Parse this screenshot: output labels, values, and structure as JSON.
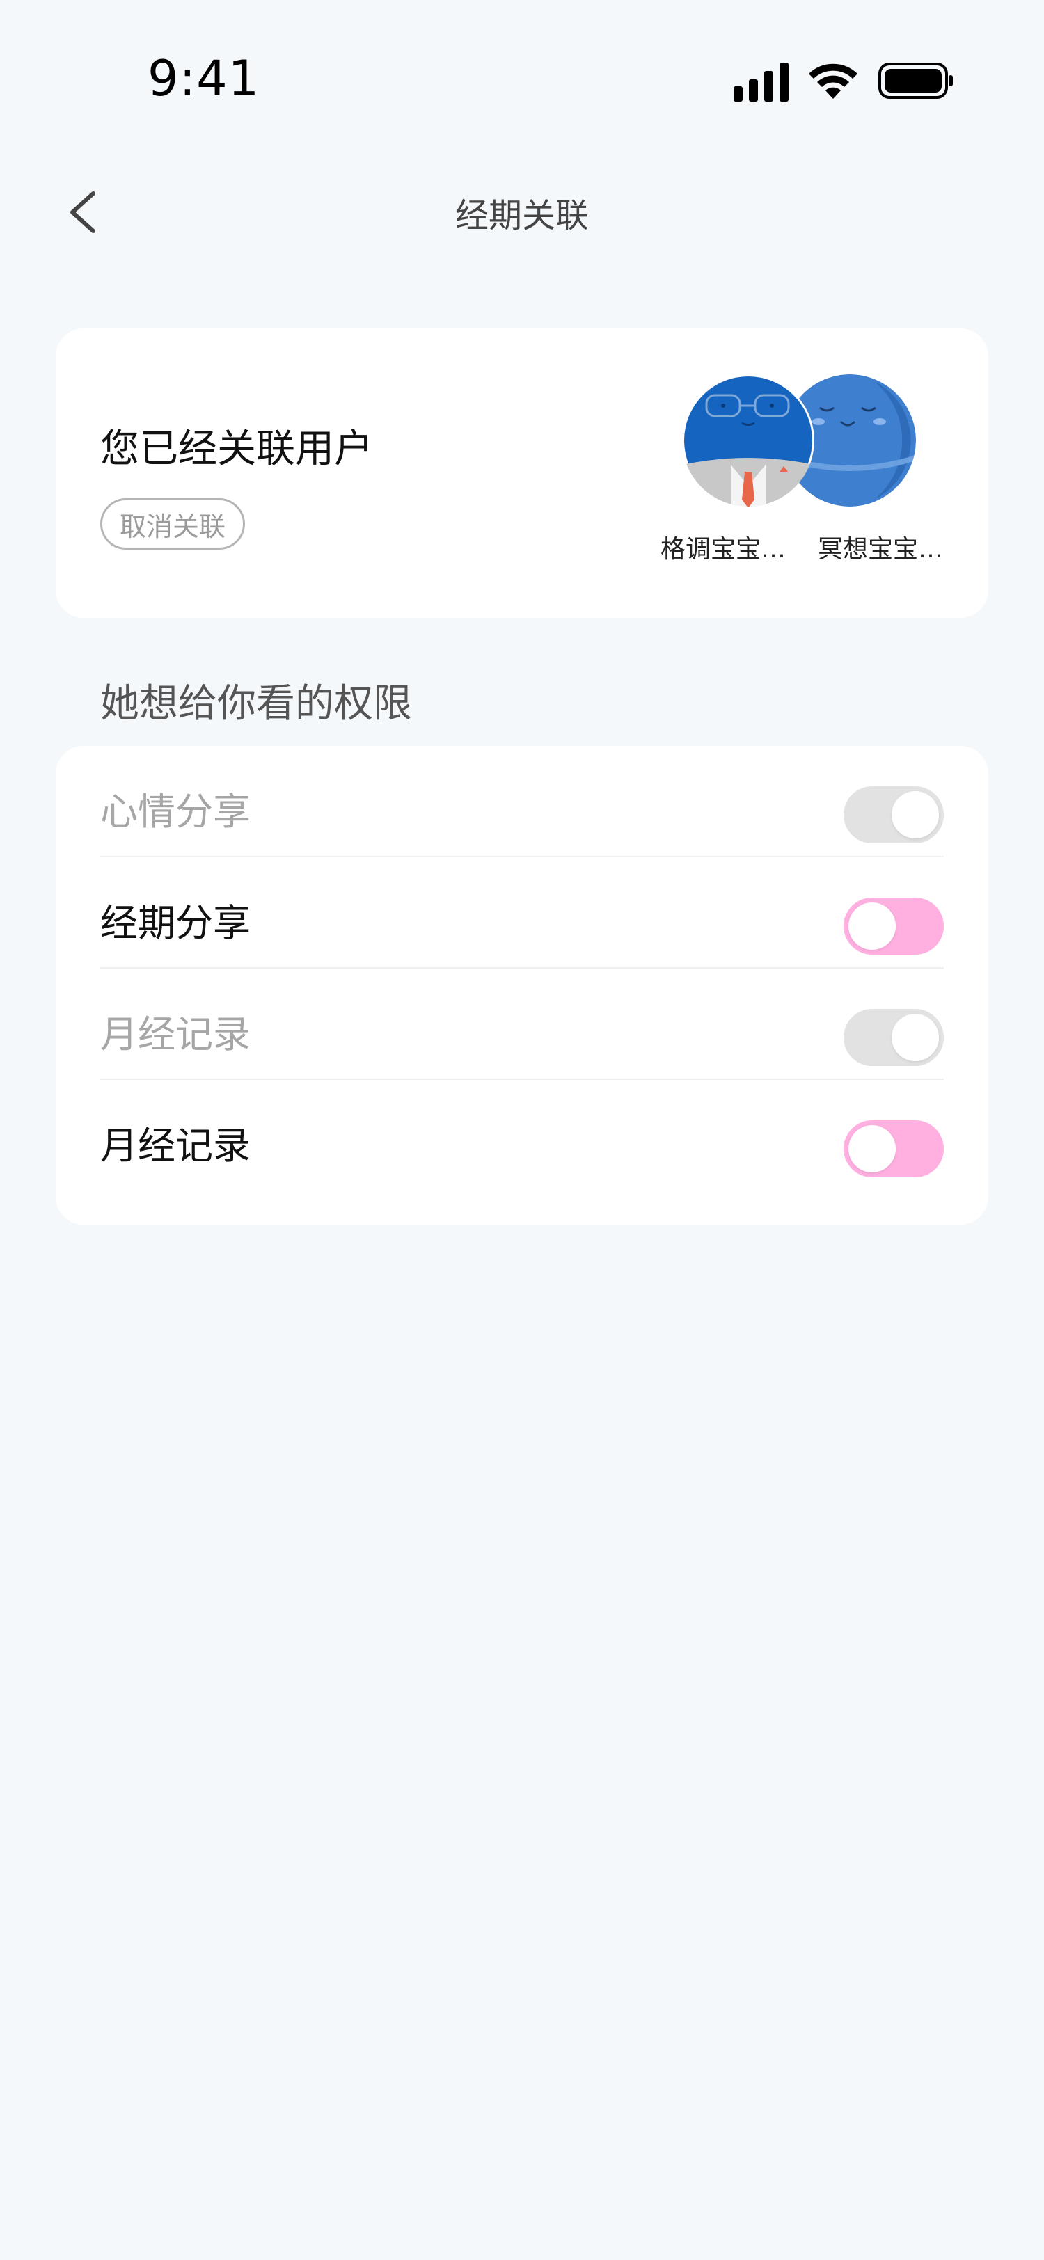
{
  "status_bar": {
    "time": "9:41"
  },
  "nav": {
    "title": "经期关联"
  },
  "linked_card": {
    "title": "您已经关联用户",
    "unlink_label": "取消关联",
    "users": [
      {
        "name": "格调宝宝…"
      },
      {
        "name": "冥想宝宝…"
      }
    ]
  },
  "permissions": {
    "section_title": "她想给你看的权限",
    "items": [
      {
        "label": "心情分享",
        "enabled": false
      },
      {
        "label": "经期分享",
        "enabled": true
      },
      {
        "label": "月经记录",
        "enabled": false
      },
      {
        "label": "月经记录",
        "enabled": true
      }
    ]
  },
  "colors": {
    "background": "#f5f8fb",
    "toggle_on": "#ffafe0",
    "toggle_off": "#e2e2e2",
    "avatar_blue": "#1565c0"
  }
}
